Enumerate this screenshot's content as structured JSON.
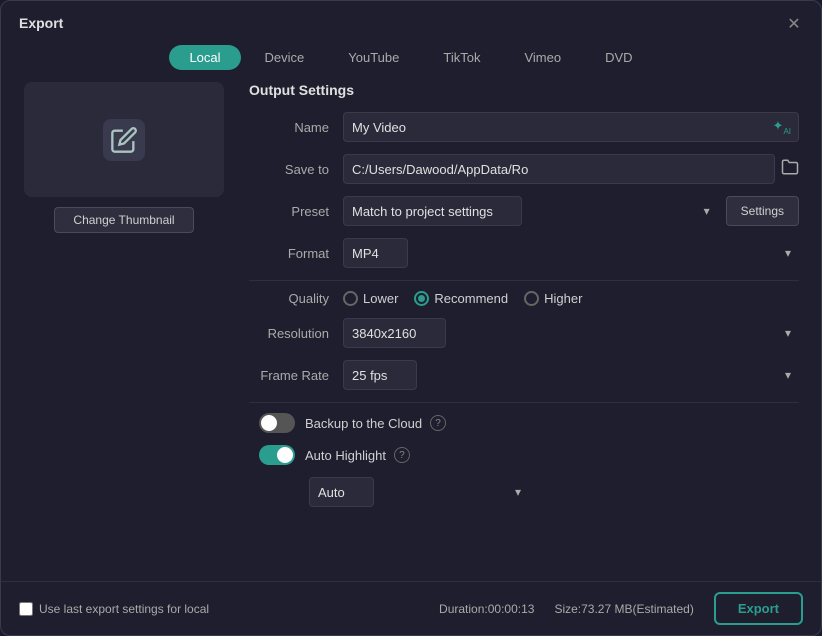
{
  "window": {
    "title": "Export"
  },
  "tabs": [
    {
      "id": "local",
      "label": "Local",
      "active": true
    },
    {
      "id": "device",
      "label": "Device",
      "active": false
    },
    {
      "id": "youtube",
      "label": "YouTube",
      "active": false
    },
    {
      "id": "tiktok",
      "label": "TikTok",
      "active": false
    },
    {
      "id": "vimeo",
      "label": "Vimeo",
      "active": false
    },
    {
      "id": "dvd",
      "label": "DVD",
      "active": false
    }
  ],
  "thumbnail": {
    "change_label": "Change Thumbnail"
  },
  "output_settings": {
    "section_title": "Output Settings",
    "name_label": "Name",
    "name_value": "My Video",
    "save_to_label": "Save to",
    "save_to_value": "C:/Users/Dawood/AppData/Ro",
    "preset_label": "Preset",
    "preset_value": "Match to project settings",
    "settings_btn": "Settings",
    "format_label": "Format",
    "format_value": "MP4",
    "quality_label": "Quality",
    "quality_lower": "Lower",
    "quality_recommend": "Recommend",
    "quality_higher": "Higher",
    "resolution_label": "Resolution",
    "resolution_value": "3840x2160",
    "frame_rate_label": "Frame Rate",
    "frame_rate_value": "25 fps",
    "backup_label": "Backup to the Cloud",
    "auto_highlight_label": "Auto Highlight",
    "auto_value": "Auto"
  },
  "footer": {
    "checkbox_label": "Use last export settings for local",
    "duration": "Duration:00:00:13",
    "size": "Size:73.27 MB(Estimated)",
    "export_btn": "Export"
  }
}
